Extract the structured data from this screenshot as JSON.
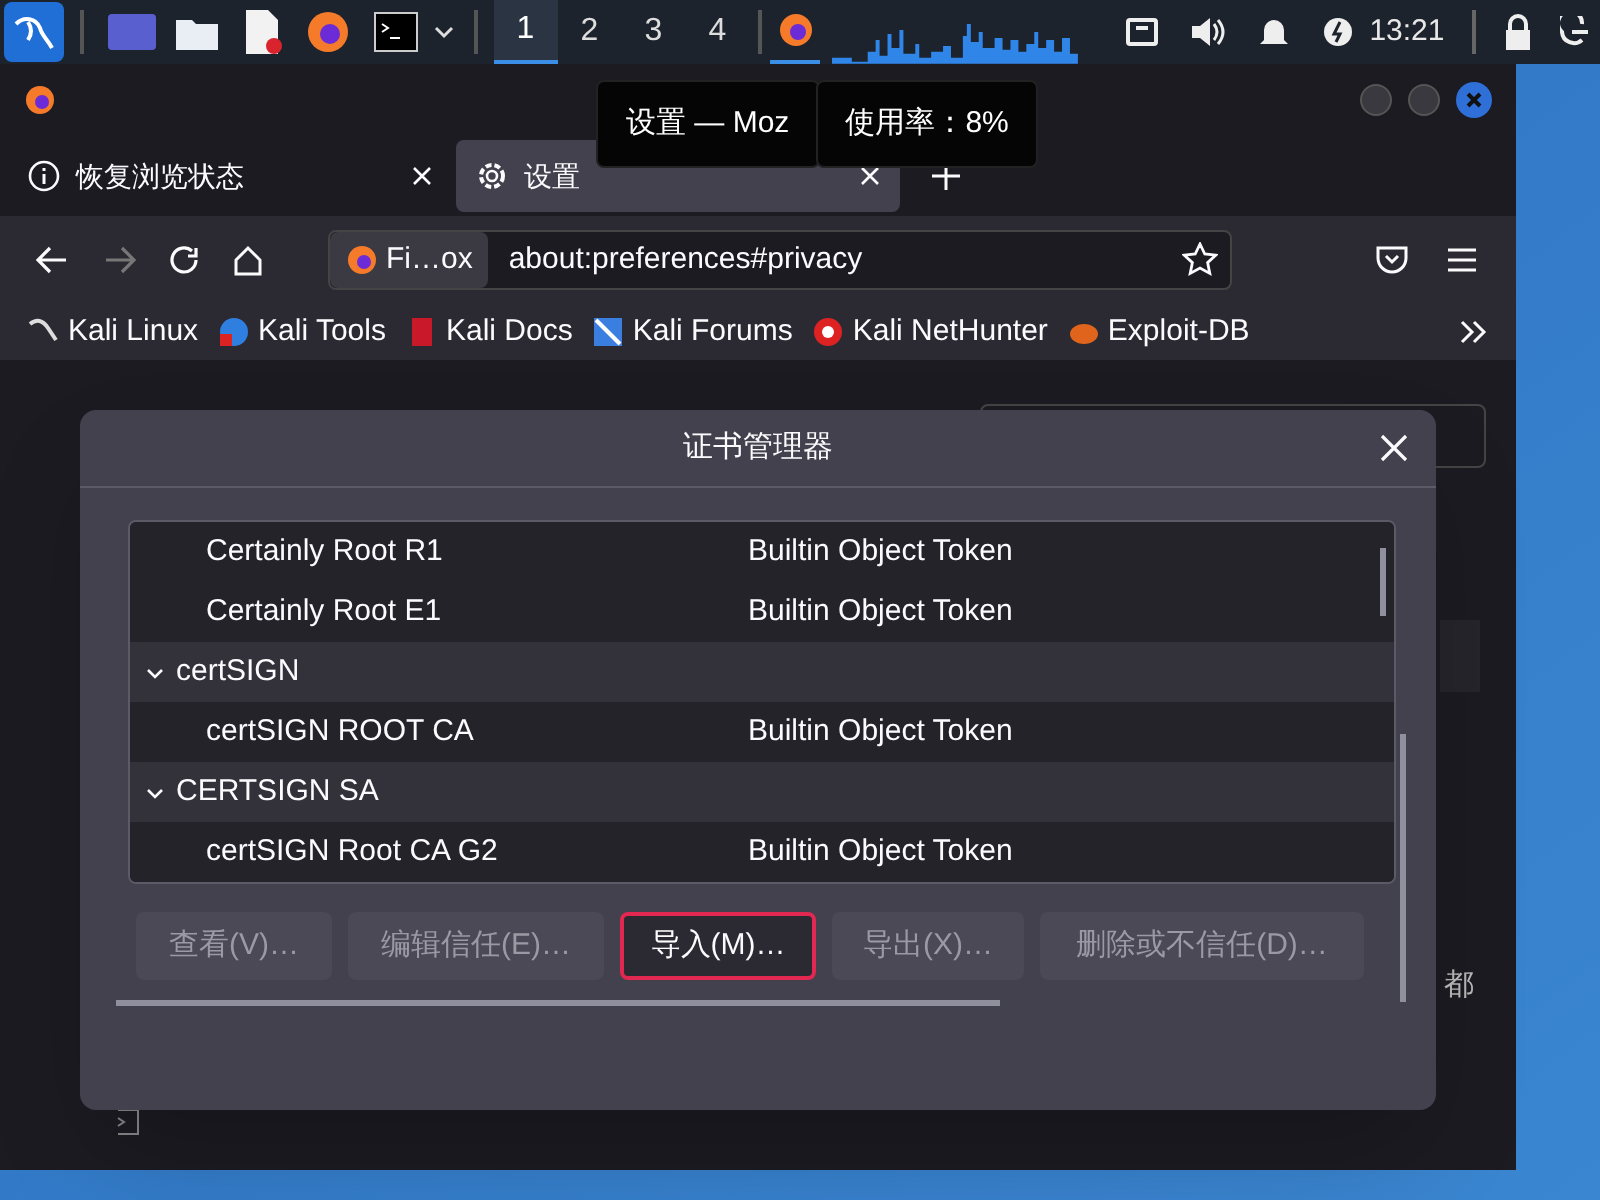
{
  "taskbar": {
    "workspaces": [
      {
        "label": "1",
        "selected": true
      },
      {
        "label": "2",
        "selected": false
      },
      {
        "label": "3",
        "selected": false
      },
      {
        "label": "4",
        "selected": false
      }
    ],
    "clock": "13:21"
  },
  "tooltips": [
    "设置 — Moz",
    "使用率：8%"
  ],
  "browser": {
    "tabs": [
      {
        "label": "恢复浏览状态",
        "selected": false
      },
      {
        "label": "设置",
        "selected": true
      }
    ],
    "identity": "Fi…ox",
    "url": "about:preferences#privacy",
    "bookmarks": [
      "Kali Linux",
      "Kali Tools",
      "Kali Docs",
      "Kali Forums",
      "Kali NetHunter",
      "Exploit-DB"
    ]
  },
  "background_text": "都",
  "dialog": {
    "title": "证书管理器",
    "tree": [
      {
        "children": [
          {
            "name": "Certainly Root R1",
            "token": "Builtin Object Token"
          },
          {
            "name": "Certainly Root E1",
            "token": "Builtin Object Token"
          }
        ]
      },
      {
        "name": "certSIGN",
        "expanded": true,
        "children": [
          {
            "name": "certSIGN ROOT CA",
            "token": "Builtin Object Token"
          }
        ]
      },
      {
        "name": "CERTSIGN SA",
        "expanded": true,
        "children": [
          {
            "name": "certSIGN Root CA G2",
            "token": "Builtin Object Token"
          }
        ]
      }
    ],
    "buttons": [
      {
        "label": "查看(V)…",
        "disabled": true,
        "focused": false
      },
      {
        "label": "编辑信任(E)…",
        "disabled": true,
        "focused": false
      },
      {
        "label": "导入(M)…",
        "disabled": false,
        "focused": true
      },
      {
        "label": "导出(X)…",
        "disabled": true,
        "focused": false
      },
      {
        "label": "删除或不信任(D)…",
        "disabled": true,
        "focused": false
      }
    ]
  }
}
